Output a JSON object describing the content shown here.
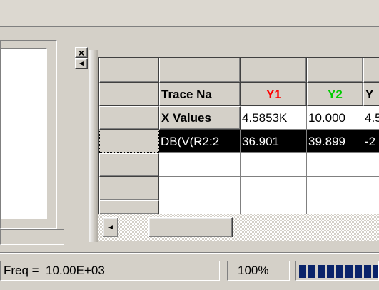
{
  "window": {
    "close_glyph": "×",
    "arrow_left_glyph": "◄"
  },
  "grid": {
    "header_row": [
      "",
      "",
      "",
      "",
      ""
    ],
    "trace_row": {
      "label": "Trace Na",
      "cols": [
        {
          "text": "Y1",
          "color": "#ff0000"
        },
        {
          "text": "Y2",
          "color": "#00cc00"
        },
        {
          "text": "Y",
          "color": "#000000"
        }
      ]
    },
    "xvalues_row": {
      "label": "X Values",
      "values": [
        "4.5853K",
        "10.000",
        "4.5"
      ]
    },
    "selected_row": {
      "label": "DB(V(R2:2",
      "values": [
        "36.901",
        "39.899",
        "-2"
      ]
    },
    "empty_rows": 3
  },
  "status": {
    "freq": "Freq =  10.00E+03",
    "zoom": "100%",
    "progress_percent": 100
  }
}
